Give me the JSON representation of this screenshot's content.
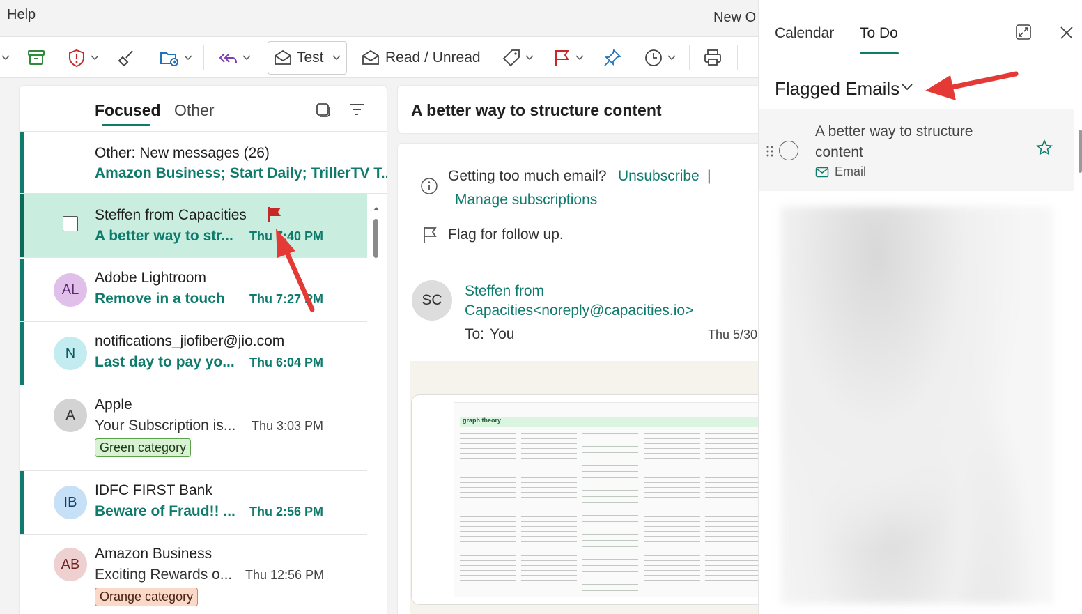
{
  "menu": {
    "help": "Help",
    "new_outlook": "New O"
  },
  "ribbon": {
    "test_label": "Test",
    "read_unread_label": "Read / Unread",
    "icons": [
      "archive-icon",
      "report-icon",
      "sweep-icon",
      "move-icon",
      "reply-all-icon",
      "test-quickstep-icon",
      "read-unread-icon",
      "tag-icon",
      "flag-icon",
      "pin-icon",
      "snooze-icon",
      "print-icon"
    ]
  },
  "mail_list": {
    "tabs": {
      "focused": "Focused",
      "other": "Other"
    },
    "other_notice": {
      "title": "Other: New messages (26)",
      "senders": "Amazon Business; Start Daily; TrillerTV T..."
    },
    "messages": [
      {
        "sender": "Steffen from Capacities",
        "subject": "A better way to str...",
        "time": "Thu 7:40 PM",
        "unread": true,
        "selected": true,
        "flagged": true
      },
      {
        "initials": "AL",
        "sender": "Adobe Lightroom",
        "subject": "Remove in a touch",
        "time": "Thu 7:27 PM",
        "unread": true,
        "avatar_color": "#e0bfea",
        "initials_color": "#5c2a6e"
      },
      {
        "initials": "N",
        "sender": "notifications_jiofiber@jio.com",
        "subject": "Last day to pay yo...",
        "time": "Thu 6:04 PM",
        "unread": true,
        "avatar_color": "#c3ecf0",
        "initials_color": "#0c5a63"
      },
      {
        "initials": "A",
        "sender": "Apple",
        "subject": "Your Subscription is...",
        "time": "Thu 3:03 PM",
        "unread": false,
        "category": "Green category",
        "avatar_color": "#d3d3d3",
        "initials_color": "#333333"
      },
      {
        "initials": "IB",
        "sender": "IDFC FIRST Bank",
        "subject": "Beware of Fraud!! ...",
        "time": "Thu 2:56 PM",
        "unread": true,
        "avatar_color": "#c6e0f7",
        "initials_color": "#123e66"
      },
      {
        "initials": "AB",
        "sender": "Amazon Business",
        "subject": "Exciting Rewards o...",
        "time": "Thu 12:56 PM",
        "unread": false,
        "category": "Orange category",
        "avatar_color": "#efd0d0",
        "initials_color": "#6e2323"
      }
    ]
  },
  "reading": {
    "title": "A better way to structure content",
    "notice_text": "Getting too much email?",
    "unsubscribe": "Unsubscribe",
    "separator": "|",
    "manage": "Manage subscriptions",
    "flag_text": "Flag for follow up.",
    "from_initials": "SC",
    "from_line1": "Steffen from",
    "from_line2": "Capacities<noreply@capacities.io>",
    "to_label": "To:",
    "to_value": "You",
    "date": "Thu 5/30",
    "preview_heading": "graph theory"
  },
  "todo_panel": {
    "tab_calendar": "Calendar",
    "tab_todo": "To Do",
    "list_title": "Flagged Emails",
    "task": {
      "title": "A better way to structure content",
      "meta": "Email"
    }
  },
  "colors": {
    "accent": "#0f7b6c",
    "selected_bg": "#c9eedf",
    "annotation_arrow": "#e53935"
  }
}
